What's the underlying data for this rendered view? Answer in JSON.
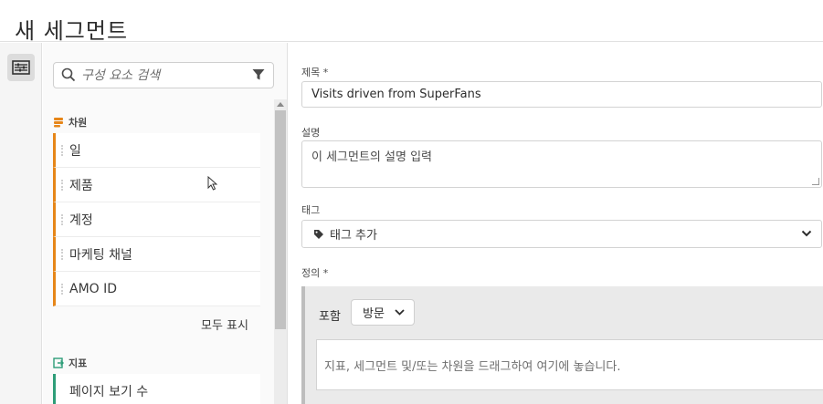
{
  "page": {
    "title": "새 세그먼트"
  },
  "rail": {
    "icon": "segment-builder-icon"
  },
  "panel": {
    "search_placeholder": "구성 요소 검색",
    "dimensions": {
      "label": "차원",
      "items": [
        "일",
        "제품",
        "계정",
        "마케팅 채널",
        "AMO ID"
      ],
      "show_all": "모두 표시"
    },
    "metrics": {
      "label": "지표",
      "items": [
        "페이지 보기 수"
      ]
    }
  },
  "main": {
    "title_label": "제목 *",
    "title_value": "Visits driven from SuperFans",
    "description_label": "설명",
    "description_placeholder": "이 세그먼트의 설명 입력",
    "tags_label": "태그",
    "tags_placeholder": "태그 추가",
    "definition_label": "정의 *",
    "include_label": "포함",
    "container_value": "방문",
    "drop_hint": "지표, 세그먼트 및/또는 차원을 드래그하여 여기에 놓습니다."
  },
  "colors": {
    "dimension_accent": "#e68619",
    "metric_accent": "#2d9d78"
  }
}
